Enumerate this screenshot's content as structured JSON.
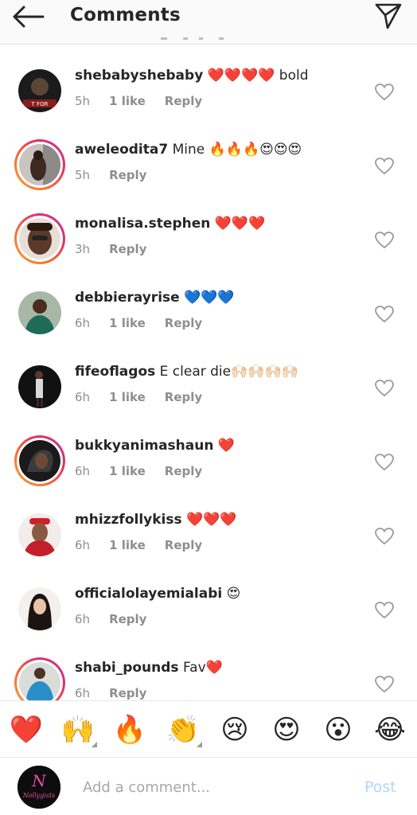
{
  "header": {
    "title": "Comments"
  },
  "comments": [
    {
      "username": "shebabyshebaby",
      "text": "❤️❤️❤️❤️ bold",
      "time": "5h",
      "likes": "1 like",
      "reply": "Reply",
      "ring": false
    },
    {
      "username": "aweleodita7",
      "text": "Mine 🔥🔥🔥😍😍😍",
      "time": "5h",
      "likes": "",
      "reply": "Reply",
      "ring": true
    },
    {
      "username": "monalisa.stephen",
      "text": "❤️❤️❤️",
      "time": "3h",
      "likes": "",
      "reply": "Reply",
      "ring": true
    },
    {
      "username": "debbierayrise",
      "text": "💙💙💙",
      "time": "6h",
      "likes": "1 like",
      "reply": "Reply",
      "ring": false
    },
    {
      "username": "fifeoflagos",
      "text": "E clear die🙌🏻🙌🏻🙌🏻🙌🏻",
      "time": "6h",
      "likes": "1 like",
      "reply": "Reply",
      "ring": false
    },
    {
      "username": "bukkyanimashaun",
      "text": "❤️",
      "time": "6h",
      "likes": "1 like",
      "reply": "Reply",
      "ring": true
    },
    {
      "username": "mhizzfollykiss",
      "text": "❤️❤️❤️",
      "time": "6h",
      "likes": "1 like",
      "reply": "Reply",
      "ring": false
    },
    {
      "username": "officialolayemialabi",
      "text": "😍",
      "time": "6h",
      "likes": "",
      "reply": "Reply",
      "ring": false
    },
    {
      "username": "shabi_pounds",
      "text": "Fav❤️",
      "time": "6h",
      "likes": "",
      "reply": "Reply",
      "ring": true
    }
  ],
  "emoji_bar": [
    {
      "glyph": "❤️",
      "name": "red-heart-emoji",
      "skin_tone": false
    },
    {
      "glyph": "🙌",
      "name": "raising-hands-emoji",
      "skin_tone": true
    },
    {
      "glyph": "🔥",
      "name": "fire-emoji",
      "skin_tone": false
    },
    {
      "glyph": "👏",
      "name": "clapping-hands-emoji",
      "skin_tone": true
    },
    {
      "glyph": "😢",
      "name": "crying-face-emoji",
      "skin_tone": false
    },
    {
      "glyph": "😍",
      "name": "heart-eyes-emoji",
      "skin_tone": false
    },
    {
      "glyph": "😮",
      "name": "surprised-face-emoji",
      "skin_tone": false
    },
    {
      "glyph": "😂",
      "name": "tears-of-joy-emoji",
      "skin_tone": false
    }
  ],
  "composer": {
    "placeholder": "Add a comment...",
    "post_label": "Post",
    "avatar_text": "Nollygists"
  },
  "colors": {
    "text": "#262626",
    "meta": "#8e8e8e",
    "post_disabled": "#b3d6f8",
    "story_ring": "#e1306c"
  },
  "icons": {
    "back": "arrow-left-icon",
    "share": "paper-plane-icon",
    "like": "heart-outline-icon"
  }
}
